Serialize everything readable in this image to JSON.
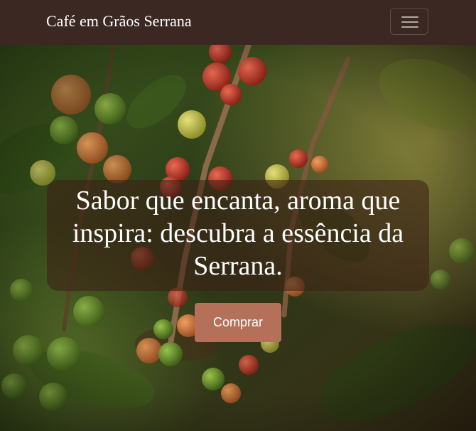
{
  "navbar": {
    "brand": "Café em Grãos Serrana",
    "toggler_icon": "hamburger-menu-icon"
  },
  "hero": {
    "background_image": "coffee-cherries-on-branch-photo",
    "headline": "Sabor que encanta, aroma que inspira: descubra a essência da Serrana.",
    "cta_label": "Comprar"
  },
  "colors": {
    "navbar_bg": "#3b2822",
    "cta_bg": "#b5705a",
    "overlay": "rgba(60,32,20,0.58)"
  }
}
